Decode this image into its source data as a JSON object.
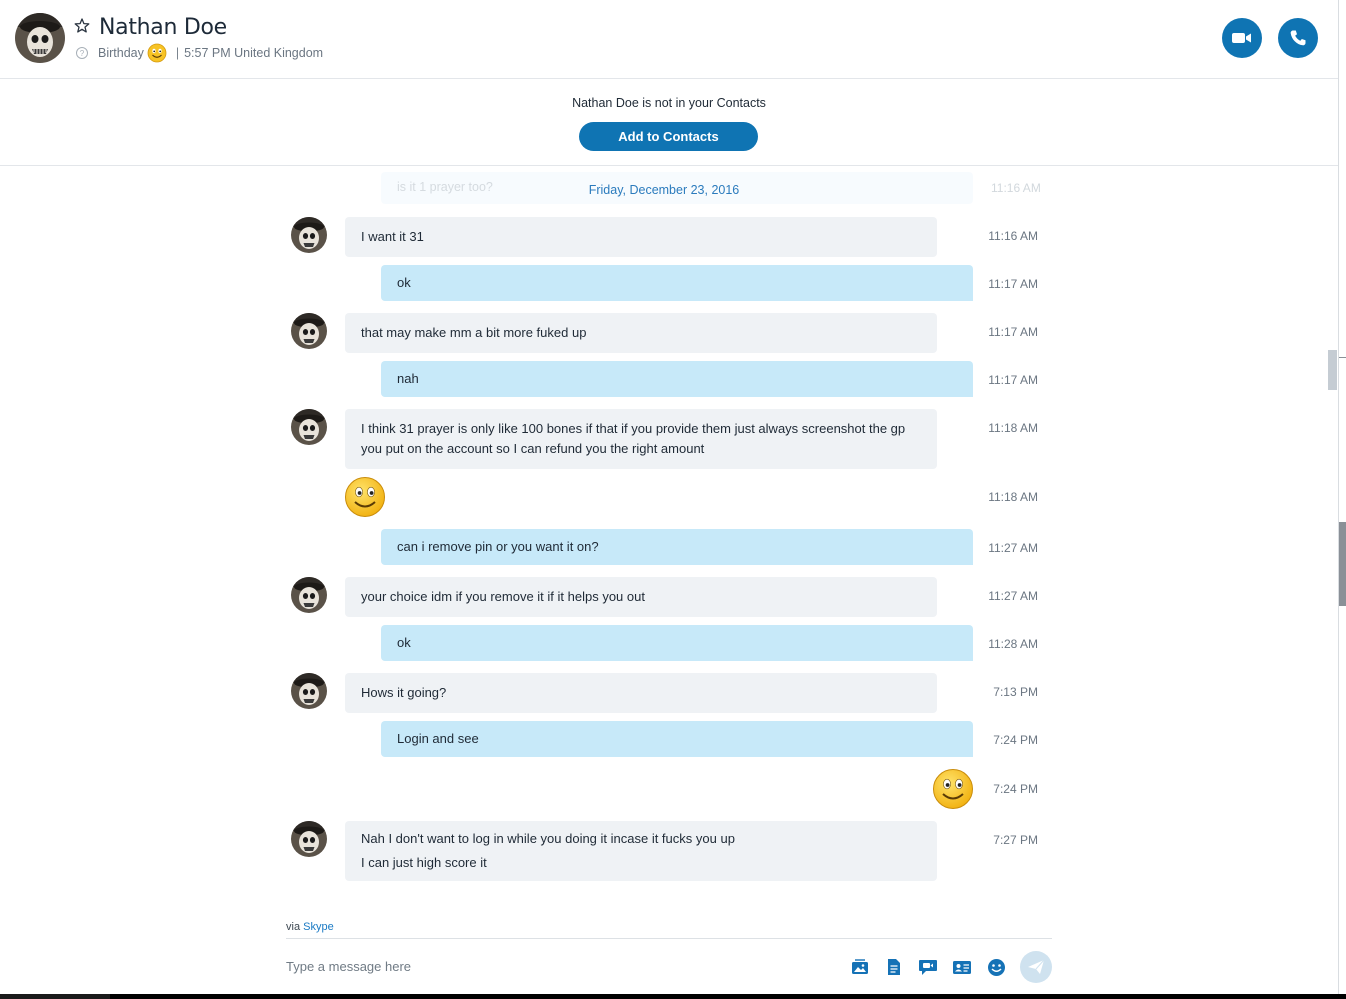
{
  "header": {
    "contact_name": "Nathan Doe",
    "birthday_label": "Birthday",
    "separator": "|",
    "local_time": "5:57 PM United Kingdom",
    "video_call_icon": "video-camera-icon",
    "audio_call_icon": "phone-icon"
  },
  "banner": {
    "text": "Nathan Doe is not in your Contacts",
    "add_button": "Add to Contacts"
  },
  "chat": {
    "ghost_text": "is it 1 prayer too?",
    "ghost_time": "11:16 AM",
    "date_separator": "Friday, December 23, 2016",
    "messages": [
      {
        "dir": "in",
        "lines": [
          "I want it 31"
        ],
        "time": "11:16 AM"
      },
      {
        "dir": "out",
        "lines": [
          "ok"
        ],
        "time": "11:17 AM"
      },
      {
        "dir": "in",
        "lines": [
          "that may make mm a bit more fuked up"
        ],
        "time": "11:17 AM"
      },
      {
        "dir": "out",
        "lines": [
          "nah"
        ],
        "time": "11:17 AM"
      },
      {
        "dir": "in",
        "lines": [
          "I think 31 prayer is only like 100 bones if that if you provide them just always screenshot the gp you put on the account so I can refund you the right amount"
        ],
        "time": "11:18 AM"
      },
      {
        "dir": "in",
        "emoticon": "smile-emoticon",
        "time": "11:18 AM"
      },
      {
        "dir": "out",
        "lines": [
          "can i remove pin or you want it on?"
        ],
        "time": "11:27 AM"
      },
      {
        "dir": "in",
        "lines": [
          "your choice idm if you remove it if it helps you out"
        ],
        "time": "11:27 AM"
      },
      {
        "dir": "out",
        "lines": [
          "ok"
        ],
        "time": "11:28 AM"
      },
      {
        "dir": "in",
        "lines": [
          "Hows it going?"
        ],
        "time": "7:13 PM"
      },
      {
        "dir": "out",
        "lines": [
          "Login and see"
        ],
        "time": "7:24 PM"
      },
      {
        "dir": "out",
        "emoticon": "smile-emoticon",
        "time": "7:24 PM"
      },
      {
        "dir": "in",
        "lines": [
          "Nah I don't want to log in while you doing it incase it fucks you up",
          "I can just high score it"
        ],
        "time": "7:27 PM"
      }
    ]
  },
  "composer": {
    "via_prefix": "via",
    "via_link": "Skype",
    "placeholder": "Type a message here",
    "tools": [
      "media-gallery-icon",
      "file-icon",
      "video-message-icon",
      "contact-card-icon",
      "emoticon-icon"
    ],
    "send_icon": "send-icon"
  },
  "colors": {
    "accent": "#0f74b3",
    "incoming_bubble": "#eff2f5",
    "outgoing_bubble": "#c7e9f9",
    "date_text": "#2b7bbd"
  }
}
